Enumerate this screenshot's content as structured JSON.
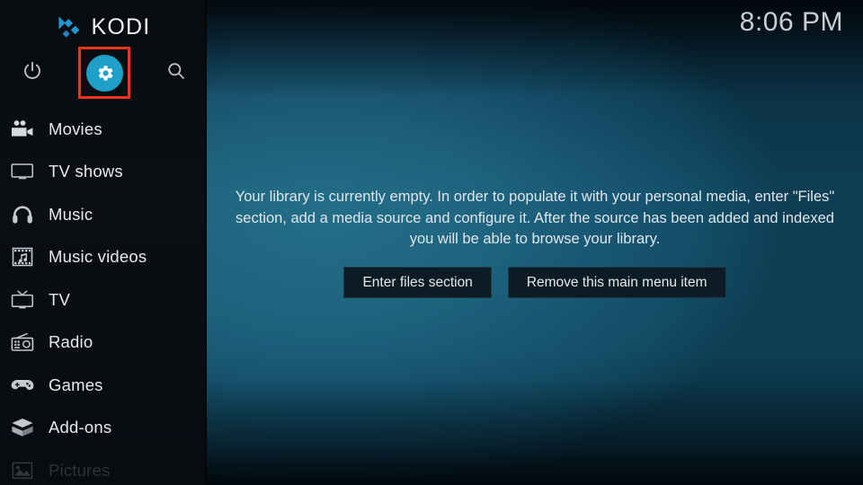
{
  "app": {
    "name": "KODI",
    "logo_icon": "kodi-diamond-logo"
  },
  "header": {
    "clock": "8:06 PM",
    "buttons": [
      {
        "name": "power",
        "icon": "power-icon",
        "label": "Power"
      },
      {
        "name": "settings",
        "icon": "gear-icon",
        "label": "Settings",
        "highlighted": true,
        "highlight_color": "#f0351c",
        "accent_color": "#1fa0c8"
      },
      {
        "name": "search",
        "icon": "search-icon",
        "label": "Search"
      }
    ]
  },
  "sidebar": {
    "items": [
      {
        "label": "Movies",
        "icon": "movie-camera-icon",
        "dim": false
      },
      {
        "label": "TV shows",
        "icon": "tv-monitor-icon",
        "dim": false
      },
      {
        "label": "Music",
        "icon": "headphones-icon",
        "dim": false
      },
      {
        "label": "Music videos",
        "icon": "music-video-icon",
        "dim": false
      },
      {
        "label": "TV",
        "icon": "tv-antenna-icon",
        "dim": false
      },
      {
        "label": "Radio",
        "icon": "radio-icon",
        "dim": false
      },
      {
        "label": "Games",
        "icon": "gamepad-icon",
        "dim": false
      },
      {
        "label": "Add-ons",
        "icon": "addon-box-icon",
        "dim": false
      },
      {
        "label": "Pictures",
        "icon": "picture-icon",
        "dim": true
      }
    ]
  },
  "main": {
    "empty_message": "Your library is currently empty. In order to populate it with your personal media, enter \"Files\" section, add a media source and configure it. After the source has been added and indexed you will be able to browse your library.",
    "buttons": [
      {
        "label": "Enter files section"
      },
      {
        "label": "Remove this main menu item"
      }
    ]
  },
  "colors": {
    "accent": "#1fa0c8",
    "highlight": "#f0351c",
    "sidebar_bg": "#080c10",
    "content_bg": "#0d3447",
    "text": "#e6eaee"
  }
}
